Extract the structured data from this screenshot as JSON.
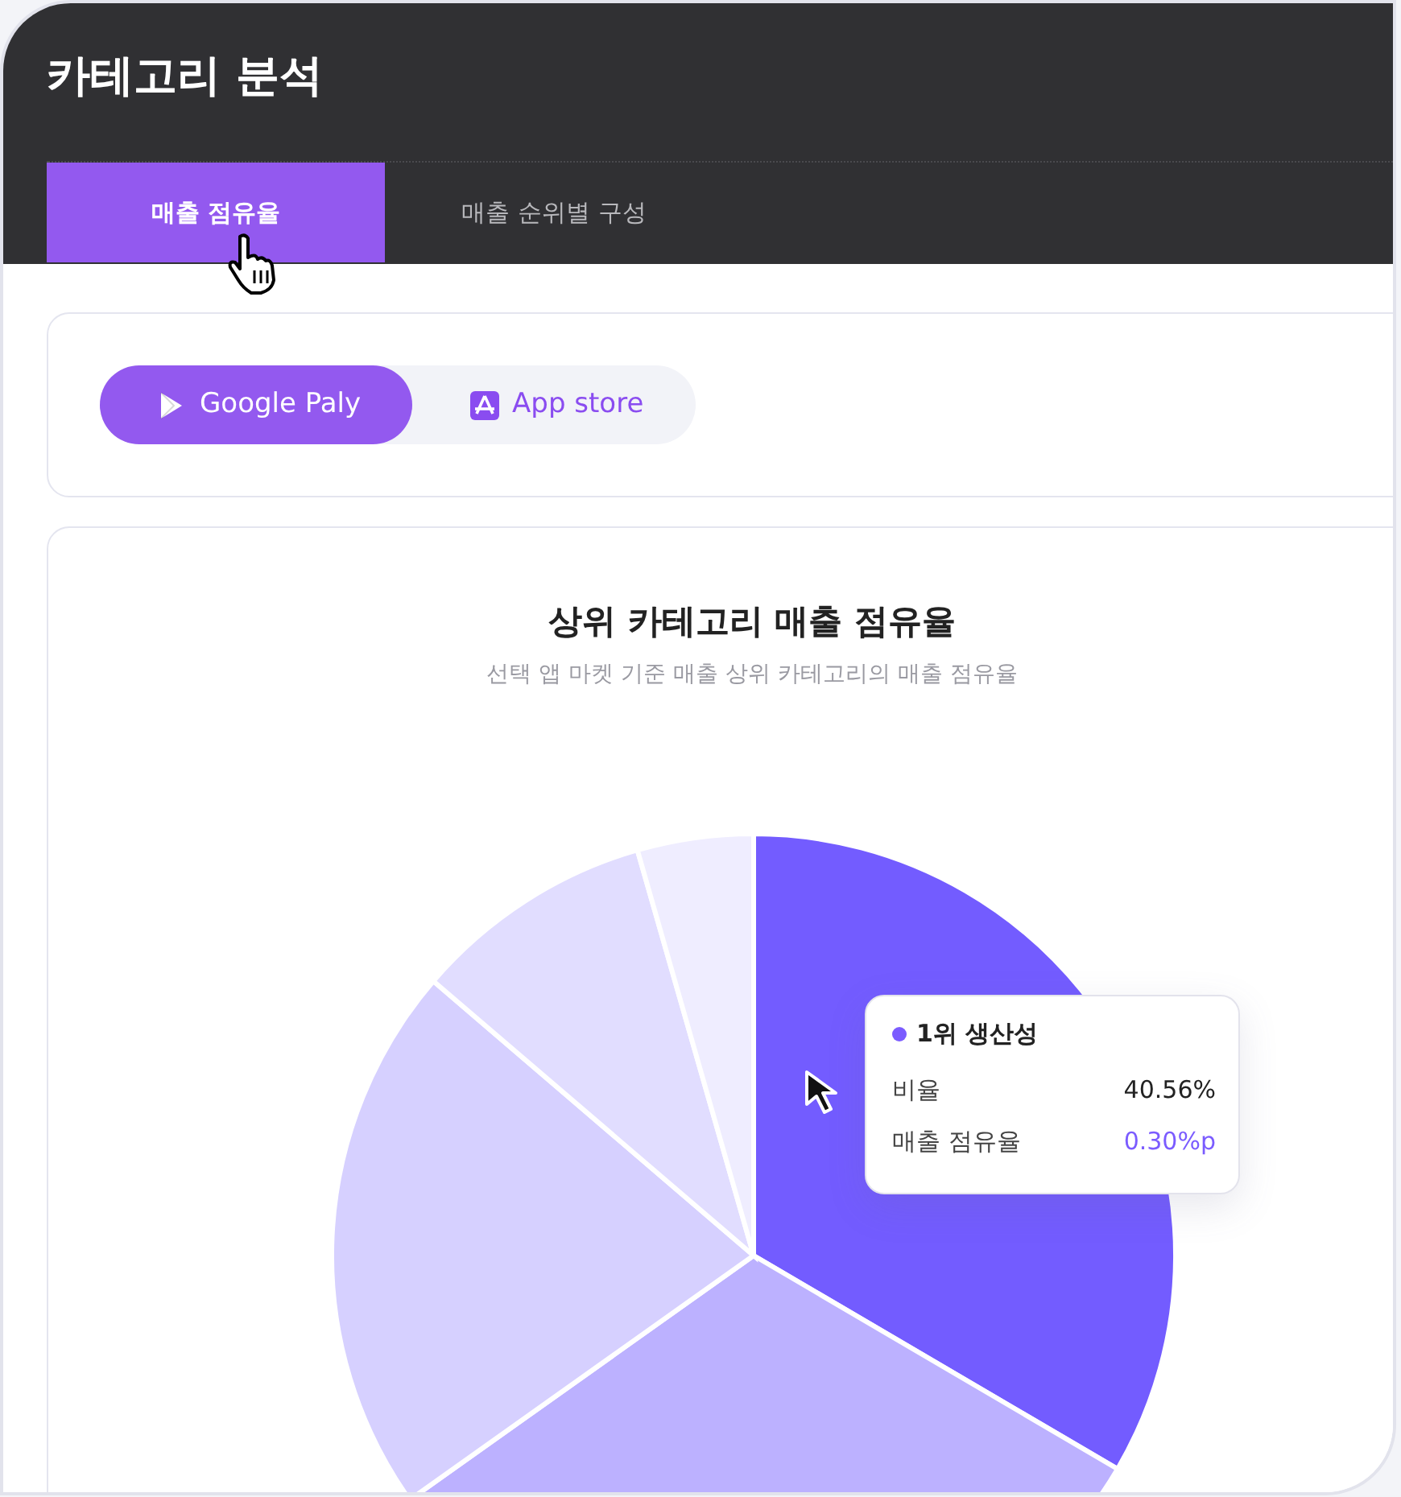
{
  "page_title": "카테고리 분석",
  "tabs": [
    {
      "label": "매출 점유율",
      "selected": true
    },
    {
      "label": "매출 순위별 구성",
      "selected": false
    }
  ],
  "store_toggle": [
    {
      "label": "Google Paly",
      "kind": "google-play",
      "selected": true
    },
    {
      "label": "App store",
      "kind": "app-store",
      "selected": false
    }
  ],
  "chart": {
    "title": "상위 카테고리 매출 점유율",
    "subtitle": "선택 앱 마켓 기준 매출 상위 카테고리의 매출 점유율",
    "tooltip": {
      "title": "1위 생산성",
      "rows": [
        {
          "label": "비율",
          "value": "40.56%",
          "kind": "plain"
        },
        {
          "label": "매출 점유율",
          "value": "0.30%p",
          "kind": "highlight"
        }
      ]
    }
  }
}
